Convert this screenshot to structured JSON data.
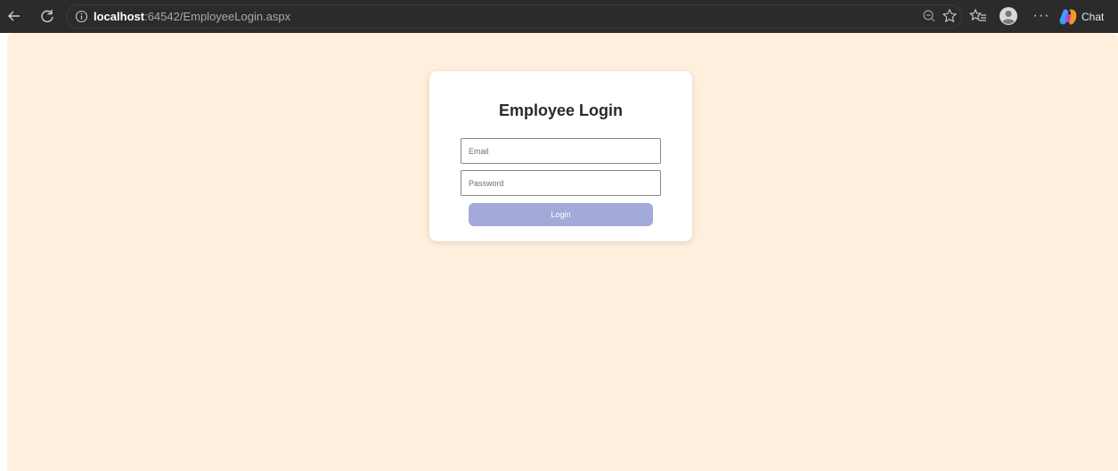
{
  "browser": {
    "url_host": "localhost",
    "url_rest": ":64542/EmployeeLogin.aspx",
    "chat_label": "Chat",
    "more_label": "···"
  },
  "login": {
    "title": "Employee Login",
    "email_placeholder": "Email",
    "password_placeholder": "Password",
    "button_label": "Login"
  },
  "colors": {
    "page_background": "#ffefdc",
    "button_background": "#a3aad9",
    "toolbar_background": "#2b2b2b"
  }
}
